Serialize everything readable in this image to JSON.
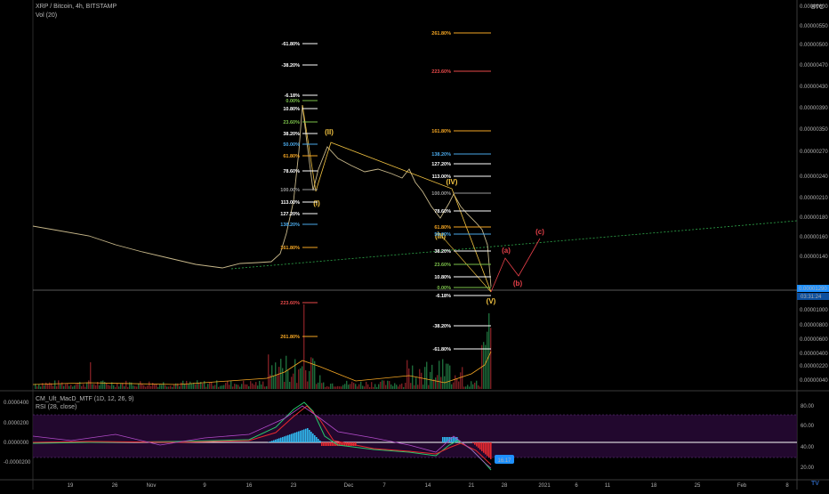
{
  "header": {
    "symbol": "XRP / Bitcoin, 4h, BITSTAMP",
    "volume": "Vol (20)",
    "indicator_1": "CM_Ult_MacD_MTF (1D, 12, 26, 9)",
    "indicator_2": "RSI (28, close)",
    "currency": "BTC",
    "tv_logo": "TV"
  },
  "colors": {
    "background": "#000000",
    "price_line": "#c8b88a",
    "wave_gold": "#f5c542",
    "wave_red": "#e8404a",
    "fib_white": "#ffffff",
    "fib_green": "#7cc24a",
    "fib_blue": "#4aa8e8",
    "fib_red": "#e84a4a",
    "fib_orange": "#f5a623",
    "trend_green": "#2ea84a",
    "price_tag": "#1e90ff",
    "rsi_tag": "#1e90ff",
    "rsi_band": "#2a0a3a",
    "macd_green": "#27c96b",
    "macd_red": "#e8292f",
    "macd_aqua": "#2fb9f0"
  },
  "chart_data": [
    {
      "type": "line",
      "title": "XRP / Bitcoin, 4h, BITSTAMP",
      "ylabel": "BTC",
      "y_ticks": [
        "0.00000600",
        "0.00000550",
        "0.00000500",
        "0.00000470",
        "0.00000430",
        "0.00000390",
        "0.00000350",
        "0.00000270",
        "0.00000240",
        "0.00000210",
        "0.00000180",
        "0.00000160",
        "0.00000140",
        "0.00001290",
        "0.00001000",
        "0.00000800",
        "0.00000600",
        "0.00000400",
        "0.00000220",
        "0.00000040"
      ],
      "ylim": [
        1.2e-06,
        6e-06
      ],
      "x_tick_labels": [
        "19",
        "26",
        "Nov",
        "9",
        "16",
        "23",
        "Dec",
        "7",
        "14",
        "21",
        "28",
        "2021",
        "6",
        "11",
        "18",
        "25",
        "Feb",
        "8"
      ],
      "price_tag": "0.00001290",
      "countdown_tag": "03:31:24",
      "series": [
        {
          "x": [
            "2020-10-14",
            "2020-10-19",
            "2020-10-24",
            "2020-10-29",
            "2020-11-03",
            "2020-11-08",
            "2020-11-13",
            "2020-11-18",
            "2020-11-20",
            "2020-11-22",
            "2020-11-24",
            "2020-11-26",
            "2020-11-28",
            "2020-12-02",
            "2020-12-06",
            "2020-12-10",
            "2020-12-13",
            "2020-12-15",
            "2020-12-17",
            "2020-12-19",
            "2020-12-21",
            "2020-12-23"
          ],
          "y": [
            2.2e-06,
            2.1e-06,
            2e-06,
            1.9e-06,
            1.7e-06,
            1.6e-06,
            1.5e-06,
            1.7e-06,
            1.9e-06,
            2.6e-06,
            4e-06,
            3.3e-06,
            3.6e-06,
            3.4e-06,
            3.3e-06,
            3.3e-06,
            3.2e-06,
            2.5e-06,
            2.8e-06,
            2.4e-06,
            2.1e-06,
            1.3e-06
          ]
        }
      ],
      "wave_labels": {
        "gold": [
          "(I)",
          "(II)",
          "(III)",
          "(IV)",
          "(V)"
        ],
        "red": [
          "(a)",
          "(b)",
          "(c)"
        ]
      },
      "fib_upper": [
        "-61.80%",
        "-38.20%",
        "-6.18%",
        "0.00%",
        "10.80%",
        "23.60%",
        "38.20%",
        "50.00%",
        "61.80%",
        "78.60%",
        "100.00%",
        "113.00%",
        "127.20%",
        "138.20%",
        "161.80%",
        "223.60%",
        "261.80%"
      ],
      "fib_right": [
        "261.80%",
        "223.60%",
        "161.80%",
        "138.20%",
        "127.20%",
        "113.00%",
        "100.00%",
        "78.60%",
        "61.80%",
        "50.00%",
        "38.20%",
        "23.60%",
        "10.80%",
        "0.00%",
        "-6.18%",
        "-38.20%",
        "-61.80%"
      ]
    },
    {
      "type": "bar",
      "title": "Vol (20)",
      "note": "volume histogram"
    },
    {
      "type": "line",
      "title": "CM_Ult_MacD_MTF (1D, 12, 26, 9) / RSI (28, close)",
      "y_ticks_left": [
        "0.0000400",
        "0.0000200",
        "0.0000000",
        "-0.0000200"
      ],
      "y_ticks_right": [
        "80.00",
        "60.00",
        "40.00",
        "20.00"
      ],
      "rsi_value": "16.17"
    }
  ]
}
